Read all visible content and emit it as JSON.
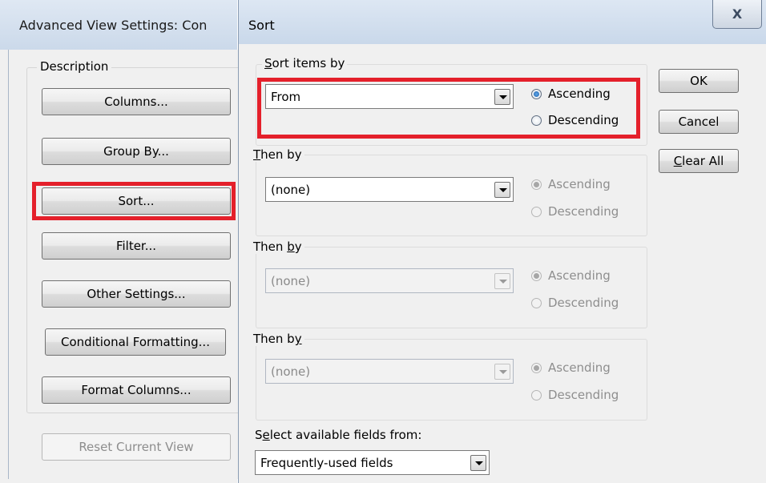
{
  "advanced_view": {
    "title": "Advanced View Settings: Con",
    "group_label": "Description",
    "buttons": [
      {
        "label": "Columns..."
      },
      {
        "label": "Group By..."
      },
      {
        "label": "Sort..."
      },
      {
        "label": "Filter..."
      },
      {
        "label": "Other Settings..."
      },
      {
        "label": "Conditional Formatting..."
      },
      {
        "label": "Format Columns..."
      }
    ],
    "reset_label": "Reset Current View"
  },
  "sort_dialog": {
    "title": "Sort",
    "close_glyph": "X",
    "sort_items_by": {
      "label_prefix": "S",
      "label_rest": "ort items by",
      "value": "From",
      "ascending": "Ascending",
      "descending": "Descending",
      "selected": "ascending"
    },
    "then_by_1": {
      "label_prefix": "T",
      "label_rest": "hen by",
      "value": "(none)",
      "ascending": "Ascending",
      "descending": "Descending"
    },
    "then_by_2": {
      "label_start": "Then ",
      "label_u": "b",
      "label_end": "y",
      "value": "(none)",
      "ascending": "Ascending",
      "descending": "Descending"
    },
    "then_by_3": {
      "label_start": "Then b",
      "label_u": "y",
      "value": "(none)",
      "ascending": "Ascending",
      "descending": "Descending"
    },
    "fields_label_start": "S",
    "fields_label_u": "e",
    "fields_label_end": "lect available fields from:",
    "fields_value": "Frequently-used fields",
    "ok_label": "OK",
    "cancel_label": "Cancel",
    "clear_prefix": "C",
    "clear_rest": "lear All"
  },
  "colors": {
    "highlight": "#e4202b",
    "window_bg": "#f0f0f0"
  }
}
